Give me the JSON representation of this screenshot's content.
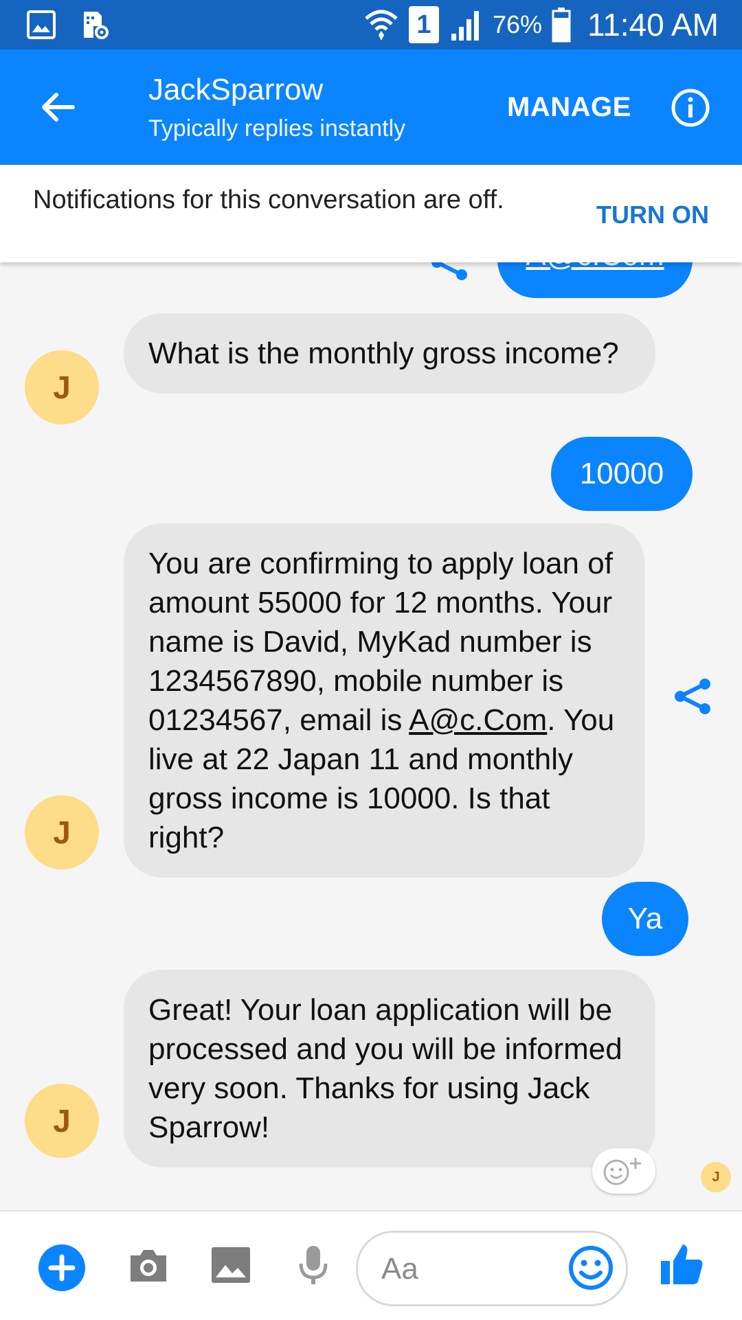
{
  "status_bar": {
    "battery": "76%",
    "time": "11:40 AM",
    "sim_slot": "1"
  },
  "header": {
    "title": "JackSparrow",
    "subtitle": "Typically replies instantly",
    "manage_label": "MANAGE"
  },
  "notice": {
    "text": "Notifications for this conversation are off.",
    "action": "TURN ON"
  },
  "avatar_initial": "J",
  "messages": {
    "partial_out": "A@c.Com",
    "m1": "What is the monthly gross income?",
    "m2_out": "10000",
    "m3_part1": "You are confirming to apply loan of amount 55000 for 12 months. Your name is David, MyKad number is 1234567890, mobile number is 01234567, email is ",
    "m3_email": "A@c.Com",
    "m3_part2": ". You live at 22 Japan 11 and monthly gross income is 10000. Is that right?",
    "m4_out": "Ya",
    "m5": "Great!  Your loan application will be processed and you will be informed very soon.  Thanks for using Jack Sparrow!"
  },
  "composer": {
    "placeholder": "Aa"
  },
  "colors": {
    "status_bar": "#1565c0",
    "app_bar": "#0b84ff",
    "outgoing_bubble": "#0b84ff",
    "incoming_bubble": "#e6e6e6",
    "avatar": "#fddc8a",
    "accent": "#1976d2"
  },
  "icons": [
    "image-icon",
    "sim-settings-icon",
    "wifi-icon",
    "signal-icon",
    "battery-icon",
    "back-arrow-icon",
    "info-icon",
    "share-icon",
    "add-reaction-icon",
    "plus-icon",
    "camera-icon",
    "gallery-icon",
    "mic-icon",
    "emoji-icon",
    "thumbs-up-icon"
  ]
}
